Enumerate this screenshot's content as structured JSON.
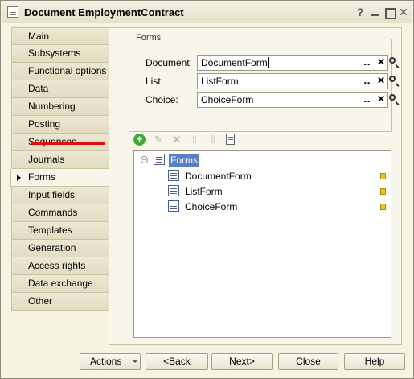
{
  "window": {
    "title": "Document EmploymentContract",
    "help_glyph": "?",
    "close_glyph": "✕"
  },
  "tabs": [
    {
      "label": "Main"
    },
    {
      "label": "Subsystems"
    },
    {
      "label": "Functional options"
    },
    {
      "label": "Data"
    },
    {
      "label": "Numbering"
    },
    {
      "label": "Posting"
    },
    {
      "label": "Sequences"
    },
    {
      "label": "Journals"
    },
    {
      "label": "Forms",
      "active": true
    },
    {
      "label": "Input fields"
    },
    {
      "label": "Commands"
    },
    {
      "label": "Templates"
    },
    {
      "label": "Generation"
    },
    {
      "label": "Access rights"
    },
    {
      "label": "Data exchange"
    },
    {
      "label": "Other"
    }
  ],
  "forms_group": {
    "title": "Forms",
    "fields": [
      {
        "label": "Document:",
        "value": "DocumentForm"
      },
      {
        "label": "List:",
        "value": "ListForm"
      },
      {
        "label": "Choice:",
        "value": "ChoiceForm"
      }
    ],
    "dots_glyph": "...",
    "clear_glyph": "✕"
  },
  "toolbar": {
    "add_glyph": "+",
    "edit_glyph": "✎",
    "delete_glyph": "✕",
    "up_glyph": "⇧",
    "down_glyph": "⇩"
  },
  "tree": {
    "collapse_glyph": "−",
    "root": "Forms",
    "items": [
      "DocumentForm",
      "ListForm",
      "ChoiceForm"
    ]
  },
  "buttons": {
    "actions": "Actions",
    "back": "<Back",
    "next": "Next>",
    "close": "Close",
    "help": "Help"
  },
  "colors": {
    "highlight": "#5a7fc4",
    "underline": "#e01010",
    "add": "#3cab3a"
  }
}
